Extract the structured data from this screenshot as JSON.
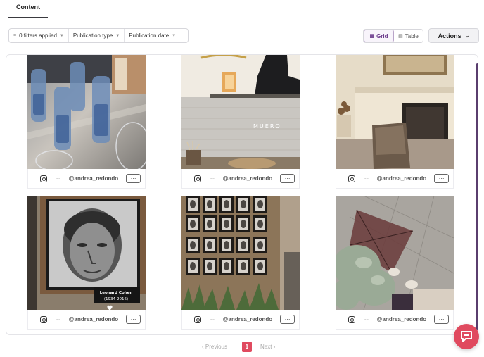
{
  "tabs": {
    "active": "Content"
  },
  "filters": {
    "applied": "0 filters applied",
    "publication_type": "Publication type",
    "publication_date": "Publication date"
  },
  "view_toggle": {
    "grid": "Grid",
    "table": "Table",
    "selected": "Grid"
  },
  "actions_label": "Actions",
  "posts": [
    {
      "handle": "@andrea_redondo",
      "network_icon": "instagram-icon",
      "menu": "···",
      "sign_text": ""
    },
    {
      "handle": "@andrea_redondo",
      "network_icon": "instagram-icon",
      "menu": "···",
      "sign_text": "MUERO"
    },
    {
      "handle": "@andrea_redondo",
      "network_icon": "instagram-icon",
      "menu": "···",
      "sign_text": ""
    },
    {
      "handle": "@andrea_redondo",
      "network_icon": "instagram-icon",
      "menu": "···",
      "caption_name": "Leonard Cohen",
      "caption_years": "(1934-2016)"
    },
    {
      "handle": "@andrea_redondo",
      "network_icon": "instagram-icon",
      "menu": "···"
    },
    {
      "handle": "@andrea_redondo",
      "network_icon": "instagram-icon",
      "menu": "···"
    }
  ],
  "pagination": {
    "prev": "Previous",
    "current": "1",
    "next": "Next"
  },
  "colors": {
    "accent": "#e04a5f",
    "scrollbar": "#5a3d6e",
    "grid_active": "#6b3a8c"
  }
}
